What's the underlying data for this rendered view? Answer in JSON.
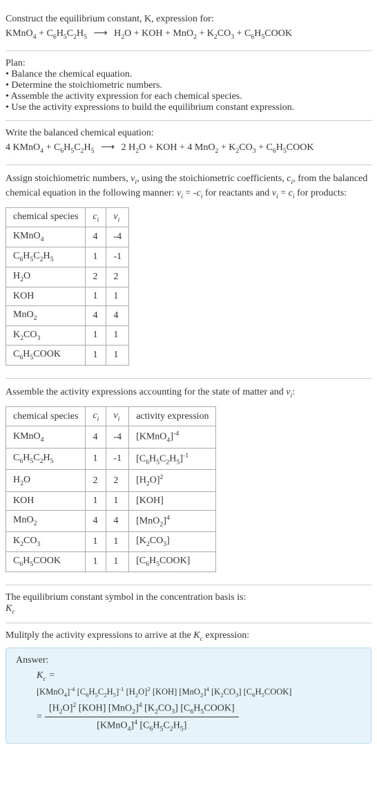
{
  "intro": {
    "line1": "Construct the equilibrium constant, K, expression for:",
    "equation_lhs": "KMnO₄ + C₆H₅C₂H₅",
    "arrow": "⟶",
    "equation_rhs": "H₂O + KOH + MnO₂ + K₂CO₃ + C₆H₅COOK"
  },
  "plan": {
    "title": "Plan:",
    "items": [
      "• Balance the chemical equation.",
      "• Determine the stoichiometric numbers.",
      "• Assemble the activity expression for each chemical species.",
      "• Use the activity expressions to build the equilibrium constant expression."
    ]
  },
  "balanced": {
    "title": "Write the balanced chemical equation:",
    "lhs": "4 KMnO₄ + C₆H₅C₂H₅",
    "arrow": "⟶",
    "rhs": "2 H₂O + KOH + 4 MnO₂ + K₂CO₃ + C₆H₅COOK"
  },
  "assign": {
    "text1": "Assign stoichiometric numbers, νᵢ, using the stoichiometric coefficients, cᵢ, from the balanced chemical equation in the following manner: νᵢ = -cᵢ for reactants and νᵢ = cᵢ for products:"
  },
  "table1": {
    "headers": [
      "chemical species",
      "cᵢ",
      "νᵢ"
    ],
    "rows": [
      [
        "KMnO₄",
        "4",
        "-4"
      ],
      [
        "C₆H₅C₂H₅",
        "1",
        "-1"
      ],
      [
        "H₂O",
        "2",
        "2"
      ],
      [
        "KOH",
        "1",
        "1"
      ],
      [
        "MnO₂",
        "4",
        "4"
      ],
      [
        "K₂CO₃",
        "1",
        "1"
      ],
      [
        "C₆H₅COOK",
        "1",
        "1"
      ]
    ]
  },
  "assemble": {
    "text": "Assemble the activity expressions accounting for the state of matter and νᵢ:"
  },
  "table2": {
    "headers": [
      "chemical species",
      "cᵢ",
      "νᵢ",
      "activity expression"
    ],
    "rows": [
      [
        "KMnO₄",
        "4",
        "-4",
        "[KMnO₄]⁻⁴"
      ],
      [
        "C₆H₅C₂H₅",
        "1",
        "-1",
        "[C₆H₅C₂H₅]⁻¹"
      ],
      [
        "H₂O",
        "2",
        "2",
        "[H₂O]²"
      ],
      [
        "KOH",
        "1",
        "1",
        "[KOH]"
      ],
      [
        "MnO₂",
        "4",
        "4",
        "[MnO₂]⁴"
      ],
      [
        "K₂CO₃",
        "1",
        "1",
        "[K₂CO₃]"
      ],
      [
        "C₆H₅COOK",
        "1",
        "1",
        "[C₆H₅COOK]"
      ]
    ]
  },
  "symbol": {
    "text": "The equilibrium constant symbol in the concentration basis is:",
    "kc": "K_c"
  },
  "multiply": {
    "text": "Mulitply the activity expressions to arrive at the K_c expression:"
  },
  "answer": {
    "label": "Answer:",
    "kc_eq": "K_c =",
    "line1": "[KMnO₄]⁻⁴ [C₆H₅C₂H₅]⁻¹ [H₂O]² [KOH] [MnO₂]⁴ [K₂CO₃] [C₆H₅COOK]",
    "eq2": "=",
    "frac_num": "[H₂O]² [KOH] [MnO₂]⁴ [K₂CO₃] [C₆H₅COOK]",
    "frac_den": "[KMnO₄]⁴ [C₆H₅C₂H₅]"
  },
  "chart_data": {
    "type": "table",
    "tables": [
      {
        "title": "Stoichiometric numbers",
        "columns": [
          "chemical species",
          "c_i",
          "ν_i"
        ],
        "rows": [
          {
            "chemical species": "KMnO4",
            "c_i": 4,
            "ν_i": -4
          },
          {
            "chemical species": "C6H5C2H5",
            "c_i": 1,
            "ν_i": -1
          },
          {
            "chemical species": "H2O",
            "c_i": 2,
            "ν_i": 2
          },
          {
            "chemical species": "KOH",
            "c_i": 1,
            "ν_i": 1
          },
          {
            "chemical species": "MnO2",
            "c_i": 4,
            "ν_i": 4
          },
          {
            "chemical species": "K2CO3",
            "c_i": 1,
            "ν_i": 1
          },
          {
            "chemical species": "C6H5COOK",
            "c_i": 1,
            "ν_i": 1
          }
        ]
      },
      {
        "title": "Activity expressions",
        "columns": [
          "chemical species",
          "c_i",
          "ν_i",
          "activity expression"
        ],
        "rows": [
          {
            "chemical species": "KMnO4",
            "c_i": 4,
            "ν_i": -4,
            "activity expression": "[KMnO4]^-4"
          },
          {
            "chemical species": "C6H5C2H5",
            "c_i": 1,
            "ν_i": -1,
            "activity expression": "[C6H5C2H5]^-1"
          },
          {
            "chemical species": "H2O",
            "c_i": 2,
            "ν_i": 2,
            "activity expression": "[H2O]^2"
          },
          {
            "chemical species": "KOH",
            "c_i": 1,
            "ν_i": 1,
            "activity expression": "[KOH]"
          },
          {
            "chemical species": "MnO2",
            "c_i": 4,
            "ν_i": 4,
            "activity expression": "[MnO2]^4"
          },
          {
            "chemical species": "K2CO3",
            "c_i": 1,
            "ν_i": 1,
            "activity expression": "[K2CO3]"
          },
          {
            "chemical species": "C6H5COOK",
            "c_i": 1,
            "ν_i": 1,
            "activity expression": "[C6H5COOK]"
          }
        ]
      }
    ]
  }
}
